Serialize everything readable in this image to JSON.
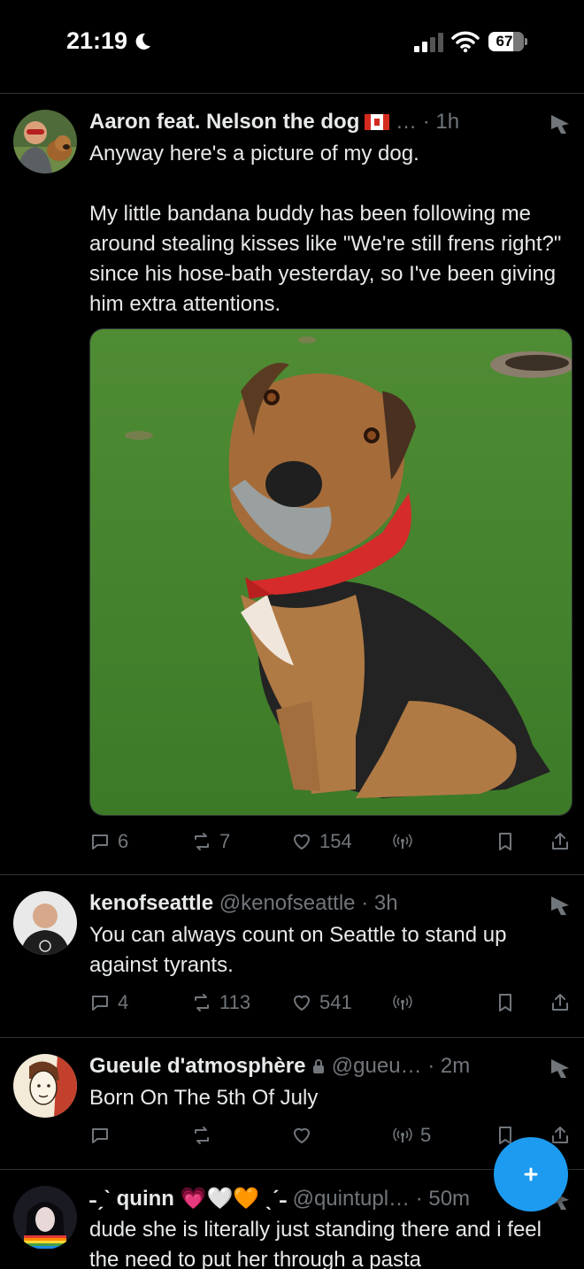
{
  "status_bar": {
    "time": "21:19",
    "battery": "67"
  },
  "tweets": [
    {
      "name": "Aaron feat. Nelson the dog",
      "meta": "… · 1h",
      "paragraphs": [
        "Anyway here's a picture of my dog.",
        "My little bandana buddy has been following me around stealing kisses like \"We're still frens right?\" since his hose-bath yesterday, so I've been giving him extra attentions."
      ],
      "replies": "6",
      "retweets": "7",
      "likes": "154",
      "views": ""
    },
    {
      "name": "kenofseattle",
      "meta": "@kenofseattle · 3h",
      "paragraphs": [
        "You can always count on Seattle to stand up against tyrants."
      ],
      "replies": "4",
      "retweets": "113",
      "likes": "541",
      "views": ""
    },
    {
      "name": "Gueule d'atmosphère",
      "meta": "@gueu… · 2m",
      "paragraphs": [
        "Born On The 5th Of July"
      ],
      "replies": "",
      "retweets": "",
      "likes": "",
      "views": "5"
    },
    {
      "name": "˗ˏˋ quinn 💗🤍🧡 ˎˊ˗",
      "meta": "@quintupl… · 50m",
      "paragraphs": [
        "dude she is literally just standing there and i feel the need to put her through a pasta"
      ]
    }
  ],
  "fab": {
    "icon": "plus"
  }
}
